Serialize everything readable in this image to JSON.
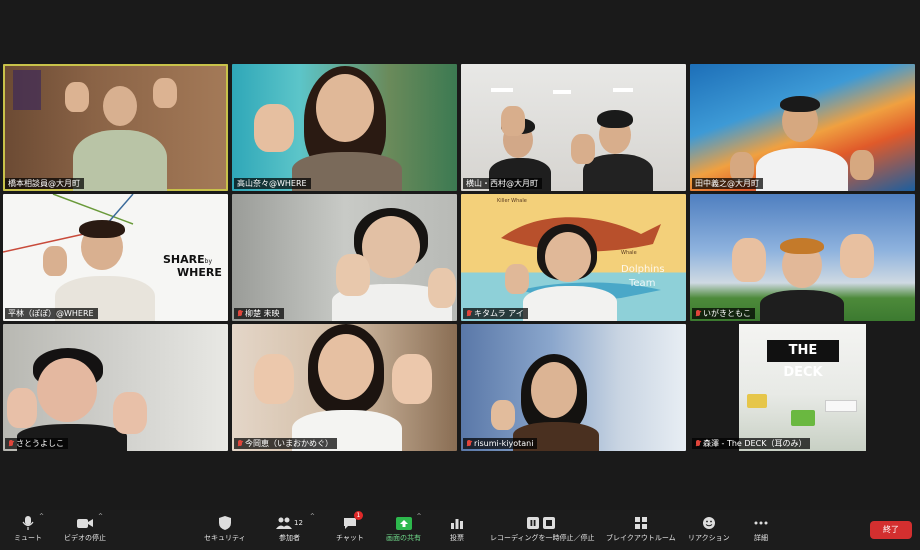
{
  "participants": [
    {
      "name": "橋本相談員@大月町",
      "muted": false
    },
    {
      "name": "高山奈々@WHERE",
      "muted": false
    },
    {
      "name": "横山・西村@大月町",
      "muted": false
    },
    {
      "name": "田中義之@大月町",
      "muted": false
    },
    {
      "name": "平林（ぽぽ）@WHERE",
      "muted": false
    },
    {
      "name": "柳楚 未映",
      "muted": true
    },
    {
      "name": "キタムラ アイ",
      "muted": true
    },
    {
      "name": "いがきともこ",
      "muted": true
    },
    {
      "name": "さとうよしこ",
      "muted": true
    },
    {
      "name": "今岡恵（いまおかめぐ）",
      "muted": true
    },
    {
      "name": "risumi-kiyotani",
      "muted": true
    },
    {
      "name": "森澤 - The DECK（耳のみ）",
      "muted": true
    }
  ],
  "backgrounds": {
    "share_logo_line1": "SHARE",
    "share_logo_by": "by",
    "share_logo_line2": "WHERE",
    "poster_line1": "Killer Whale",
    "poster_line2": "Whale",
    "poster_line3": "Dolphins",
    "poster_line4": "Team",
    "deck_logo": "THE DECK"
  },
  "toolbar": {
    "mute": "ミュート",
    "stop_video": "ビデオの停止",
    "security": "セキュリティ",
    "participants": "参加者",
    "participants_count": "12",
    "chat": "チャット",
    "chat_badge": "1",
    "share_screen": "画面の共有",
    "poll": "投票",
    "recording": "レコーディングを一時停止／停止",
    "breakout": "ブレイクアウトルーム",
    "reactions": "リアクション",
    "more": "詳細",
    "end": "終了"
  },
  "colors": {
    "active_speaker_border": "#c8c24a",
    "muted_mic": "#e0453b",
    "share_green": "#2db84d",
    "end_red": "#d32f2f"
  }
}
